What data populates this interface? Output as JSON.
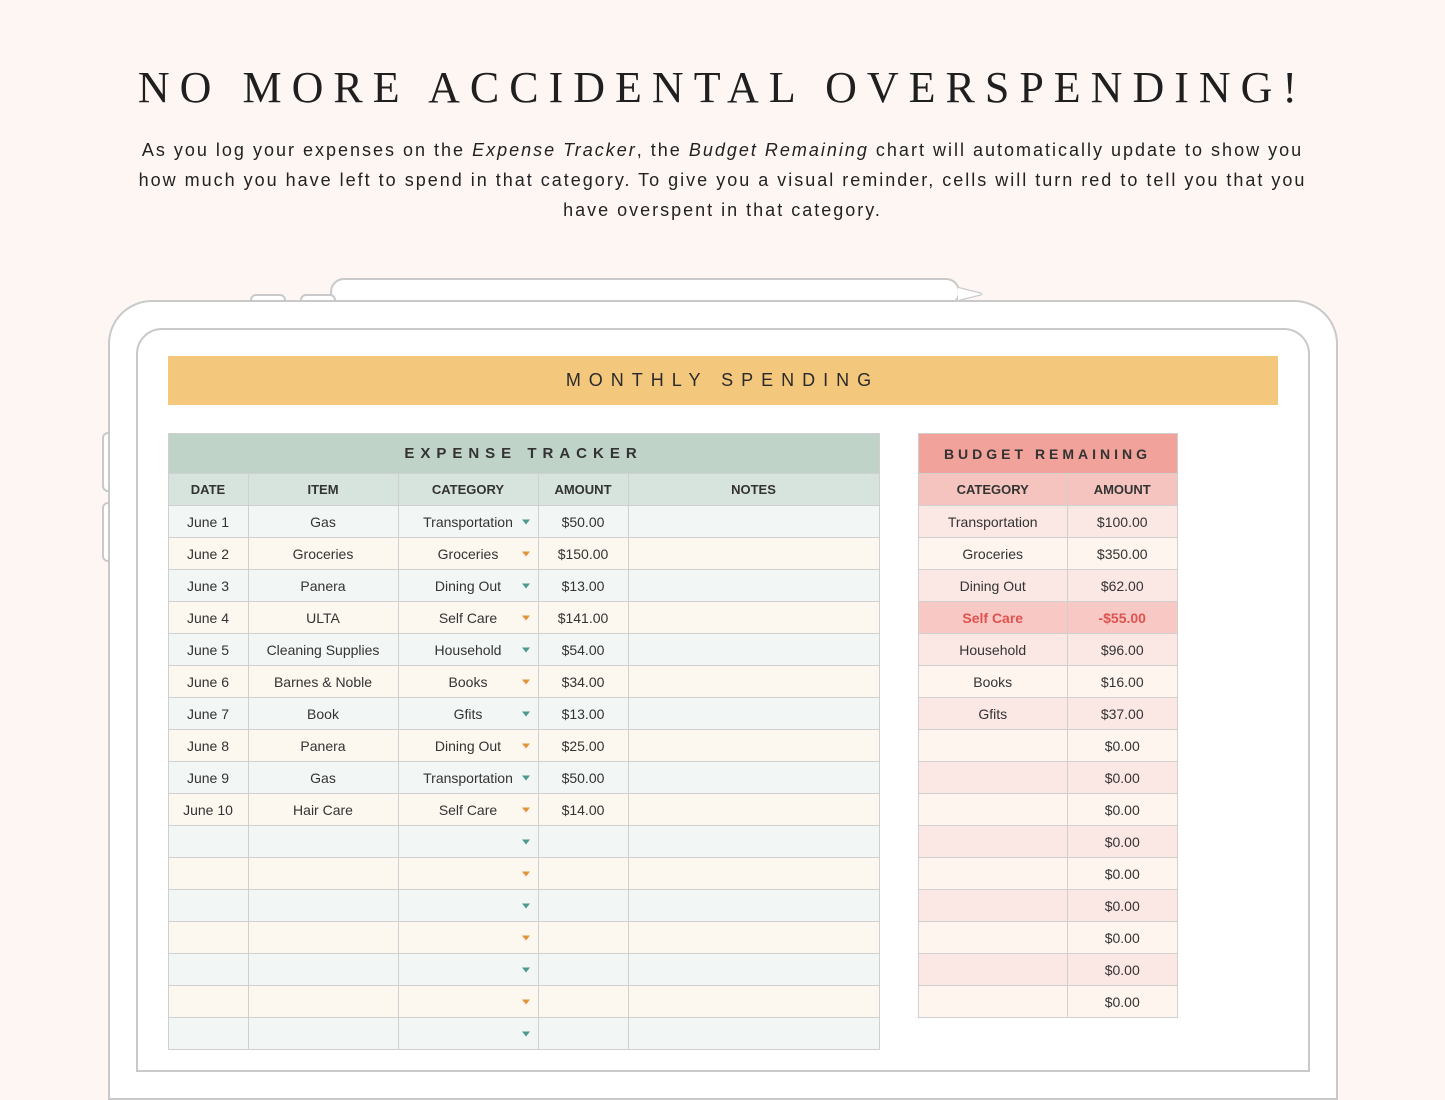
{
  "hero": {
    "title": "NO MORE ACCIDENTAL OVERSPENDING!",
    "sub_pre": "As you log your expenses on the ",
    "sub_em1": "Expense Tracker",
    "sub_mid1": ", the ",
    "sub_em2": "Budget Remaining",
    "sub_mid2": " chart will automatically update to show you how much you have left to spend in that category. To give you a visual reminder, cells will turn red to tell you that you have overspent in that category."
  },
  "banner": "MONTHLY SPENDING",
  "expense": {
    "title": "EXPENSE TRACKER",
    "headers": {
      "date": "DATE",
      "item": "ITEM",
      "category": "CATEGORY",
      "amount": "AMOUNT",
      "notes": "NOTES"
    },
    "rows": [
      {
        "date": "June 1",
        "item": "Gas",
        "category": "Transportation",
        "amount": "$50.00",
        "chev": "teal"
      },
      {
        "date": "June 2",
        "item": "Groceries",
        "category": "Groceries",
        "amount": "$150.00",
        "chev": "orange"
      },
      {
        "date": "June 3",
        "item": "Panera",
        "category": "Dining Out",
        "amount": "$13.00",
        "chev": "teal"
      },
      {
        "date": "June 4",
        "item": "ULTA",
        "category": "Self Care",
        "amount": "$141.00",
        "chev": "orange"
      },
      {
        "date": "June 5",
        "item": "Cleaning Supplies",
        "category": "Household",
        "amount": "$54.00",
        "chev": "teal"
      },
      {
        "date": "June 6",
        "item": "Barnes & Noble",
        "category": "Books",
        "amount": "$34.00",
        "chev": "orange"
      },
      {
        "date": "June 7",
        "item": "Book",
        "category": "Gfits",
        "amount": "$13.00",
        "chev": "teal"
      },
      {
        "date": "June 8",
        "item": "Panera",
        "category": "Dining Out",
        "amount": "$25.00",
        "chev": "orange"
      },
      {
        "date": "June 9",
        "item": "Gas",
        "category": "Transportation",
        "amount": "$50.00",
        "chev": "teal"
      },
      {
        "date": "June 10",
        "item": "Hair Care",
        "category": "Self Care",
        "amount": "$14.00",
        "chev": "orange"
      },
      {
        "date": "",
        "item": "",
        "category": "",
        "amount": "",
        "chev": "teal"
      },
      {
        "date": "",
        "item": "",
        "category": "",
        "amount": "",
        "chev": "orange"
      },
      {
        "date": "",
        "item": "",
        "category": "",
        "amount": "",
        "chev": "teal"
      },
      {
        "date": "",
        "item": "",
        "category": "",
        "amount": "",
        "chev": "orange"
      },
      {
        "date": "",
        "item": "",
        "category": "",
        "amount": "",
        "chev": "teal"
      },
      {
        "date": "",
        "item": "",
        "category": "",
        "amount": "",
        "chev": "orange"
      },
      {
        "date": "",
        "item": "",
        "category": "",
        "amount": "",
        "chev": "teal"
      }
    ]
  },
  "budget": {
    "title": "BUDGET REMAINING",
    "headers": {
      "category": "CATEGORY",
      "amount": "AMOUNT"
    },
    "rows": [
      {
        "category": "Transportation",
        "amount": "$100.00",
        "over": false
      },
      {
        "category": "Groceries",
        "amount": "$350.00",
        "over": false
      },
      {
        "category": "Dining Out",
        "amount": "$62.00",
        "over": false
      },
      {
        "category": "Self Care",
        "amount": "-$55.00",
        "over": true
      },
      {
        "category": "Household",
        "amount": "$96.00",
        "over": false
      },
      {
        "category": "Books",
        "amount": "$16.00",
        "over": false
      },
      {
        "category": "Gfits",
        "amount": "$37.00",
        "over": false
      },
      {
        "category": "",
        "amount": "$0.00",
        "over": false
      },
      {
        "category": "",
        "amount": "$0.00",
        "over": false
      },
      {
        "category": "",
        "amount": "$0.00",
        "over": false
      },
      {
        "category": "",
        "amount": "$0.00",
        "over": false
      },
      {
        "category": "",
        "amount": "$0.00",
        "over": false
      },
      {
        "category": "",
        "amount": "$0.00",
        "over": false
      },
      {
        "category": "",
        "amount": "$0.00",
        "over": false
      },
      {
        "category": "",
        "amount": "$0.00",
        "over": false
      },
      {
        "category": "",
        "amount": "$0.00",
        "over": false
      }
    ]
  }
}
